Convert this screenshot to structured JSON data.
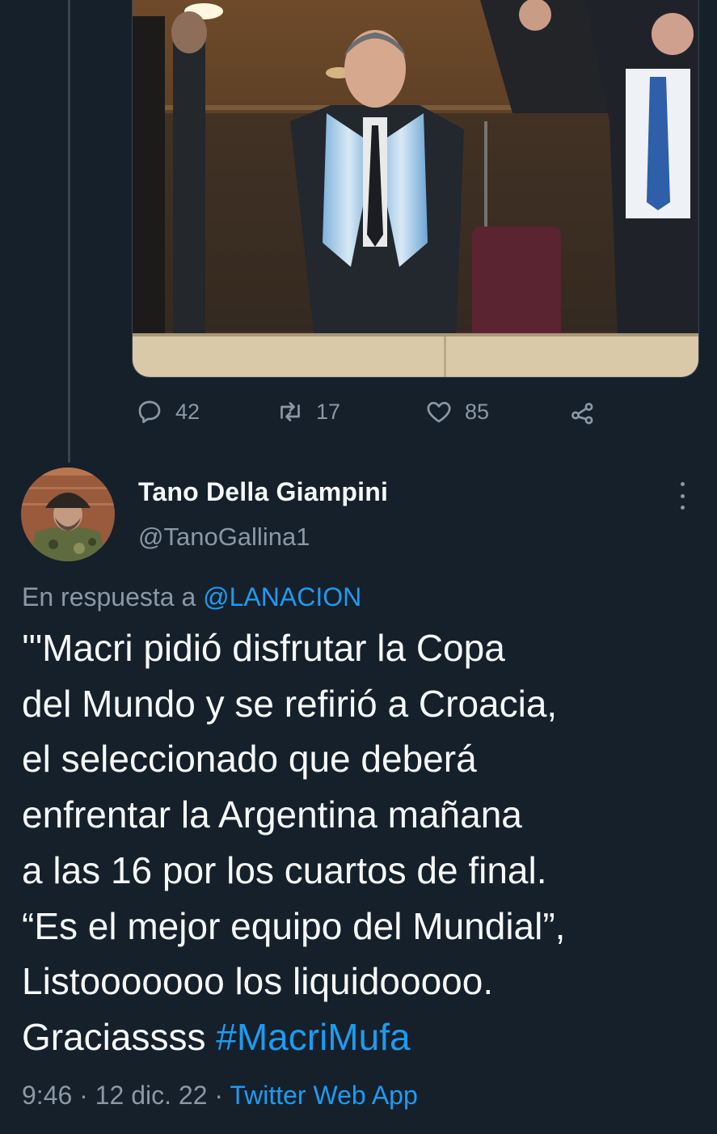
{
  "previous_tweet": {
    "stats": {
      "replies": "42",
      "retweets": "17",
      "likes": "85"
    },
    "icons": {
      "reply": "reply-icon",
      "retweet": "retweet-icon",
      "like": "heart-icon",
      "share": "share-icon"
    }
  },
  "tweet": {
    "display_name": "Tano Della Giampini",
    "handle": "@TanoGallina1",
    "reply_prefix": "En respuesta a",
    "reply_to": "@LANACION",
    "text_lines": [
      "'\"Macri pidió disfrutar la Copa",
      "del Mundo y se refirió a Croacia,",
      "el seleccionado que deberá",
      "enfrentar la Argentina mañana",
      "a las 16 por los cuartos de final.",
      "“Es el mejor equipo del Mundial”,",
      "Listooooooo los liquidooooo.",
      "Graciassss "
    ],
    "hashtag": "#MacriMufa",
    "time": "9:46",
    "separator": "·",
    "date": "12 dic. 22",
    "source": "Twitter Web App"
  },
  "colors": {
    "background": "#15202b",
    "accent": "#1d9bf0",
    "secondary_text": "#8b98a5",
    "primary_text": "#f7f9f9"
  }
}
